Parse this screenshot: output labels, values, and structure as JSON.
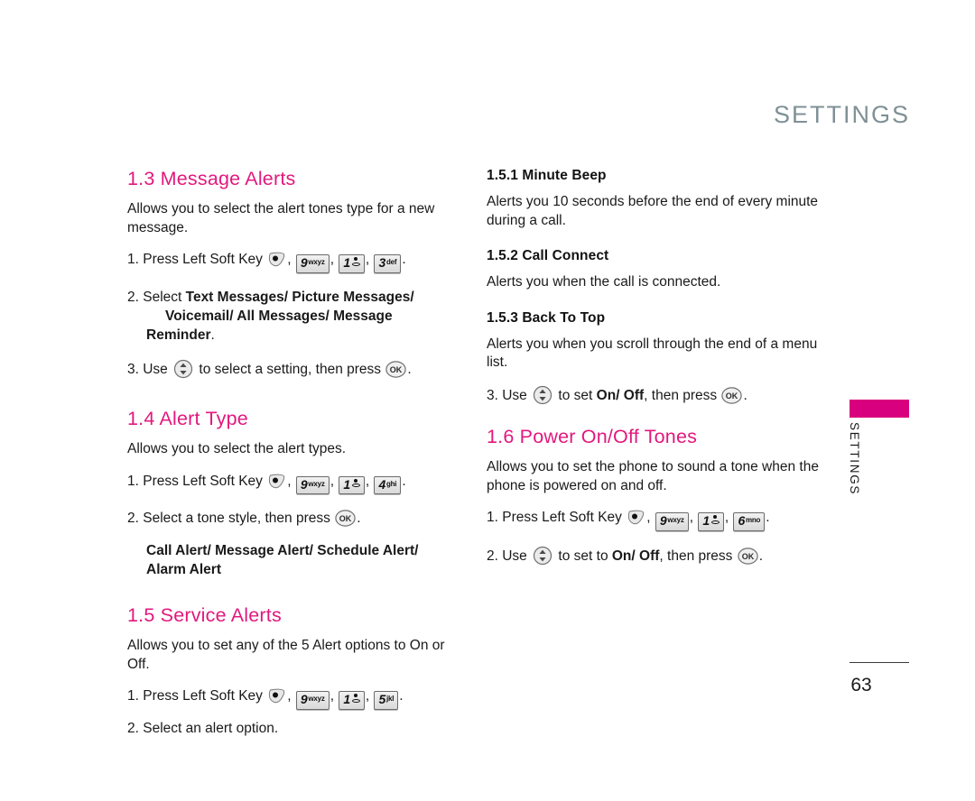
{
  "document": {
    "running_head": "SETTINGS",
    "page_number": "63",
    "thumb_tab_label": "SETTINGS",
    "accent_color": "#e2187e",
    "tab_color": "#d9007f",
    "running_head_color": "#7f9096"
  },
  "icons": {
    "soft_key": "left-soft-key-icon",
    "nav_key": "navigation-updown-key-icon",
    "ok_key": "ok-key-icon"
  },
  "keys": {
    "nine": {
      "num": "9",
      "letters": "wxyz"
    },
    "one": {
      "num": "1",
      "letters": ""
    },
    "three": {
      "num": "3",
      "letters": "def"
    },
    "four": {
      "num": "4",
      "letters": "ghi"
    },
    "five": {
      "num": "5",
      "letters": "jkl"
    },
    "six": {
      "num": "6",
      "letters": "mno"
    },
    "ok_label": "OK"
  },
  "left_column": {
    "section_1_3": {
      "title": "1.3 Message Alerts",
      "description": "Allows you to select the alert tones type for a new message.",
      "step1_prefix": "1. Press Left Soft Key",
      "step1_comma": ",",
      "step1_end": ".",
      "step2_prefix": "2. Select ",
      "step2_bold_line1": "Text Messages/ Picture Messages/",
      "step2_bold_line2": "Voicemail/ All Messages/ Message Reminder",
      "step2_end": ".",
      "step3_prefix": "3. Use ",
      "step3_middle": " to select a setting, then press ",
      "step3_end": "."
    },
    "section_1_4": {
      "title": "1.4 Alert Type",
      "description": "Allows you to select the alert types.",
      "step1_prefix": "1. Press Left Soft Key",
      "step1_comma": ",",
      "step1_end": ".",
      "step2_prefix": "2. Select a tone style, then press ",
      "step2_end": ".",
      "options_line1": "Call Alert/ Message Alert/ Schedule Alert/",
      "options_line2": "Alarm Alert"
    },
    "section_1_5": {
      "title": "1.5 Service Alerts",
      "description": "Allows you to set any of the 5 Alert options to On or Off.",
      "step1_prefix": "1. Press Left Soft Key",
      "step1_comma": ",",
      "step1_end": ".",
      "step2": "2. Select an alert option."
    }
  },
  "right_column": {
    "section_1_5_1": {
      "title": "1.5.1 Minute Beep",
      "description": "Alerts you 10 seconds before the end of every minute during a call."
    },
    "section_1_5_2": {
      "title": "1.5.2 Call Connect",
      "description": "Alerts you when the call is connected."
    },
    "section_1_5_3": {
      "title": "1.5.3 Back To Top",
      "description": "Alerts you when you scroll through the end of a menu list.",
      "step3_prefix": "3. Use ",
      "step3_middle1": " to set ",
      "step3_bold": "On/ Off",
      "step3_middle2": ", then press ",
      "step3_end": "."
    },
    "section_1_6": {
      "title": "1.6 Power On/Off Tones",
      "description": "Allows you to set the phone to sound a tone when the phone is powered on and off.",
      "step1_prefix": "1. Press Left Soft Key",
      "step1_comma": ",",
      "step1_end": ".",
      "step2_prefix": "2. Use ",
      "step2_middle1": " to set to ",
      "step2_bold": "On/ Off",
      "step2_middle2": ", then press ",
      "step2_end": "."
    }
  }
}
